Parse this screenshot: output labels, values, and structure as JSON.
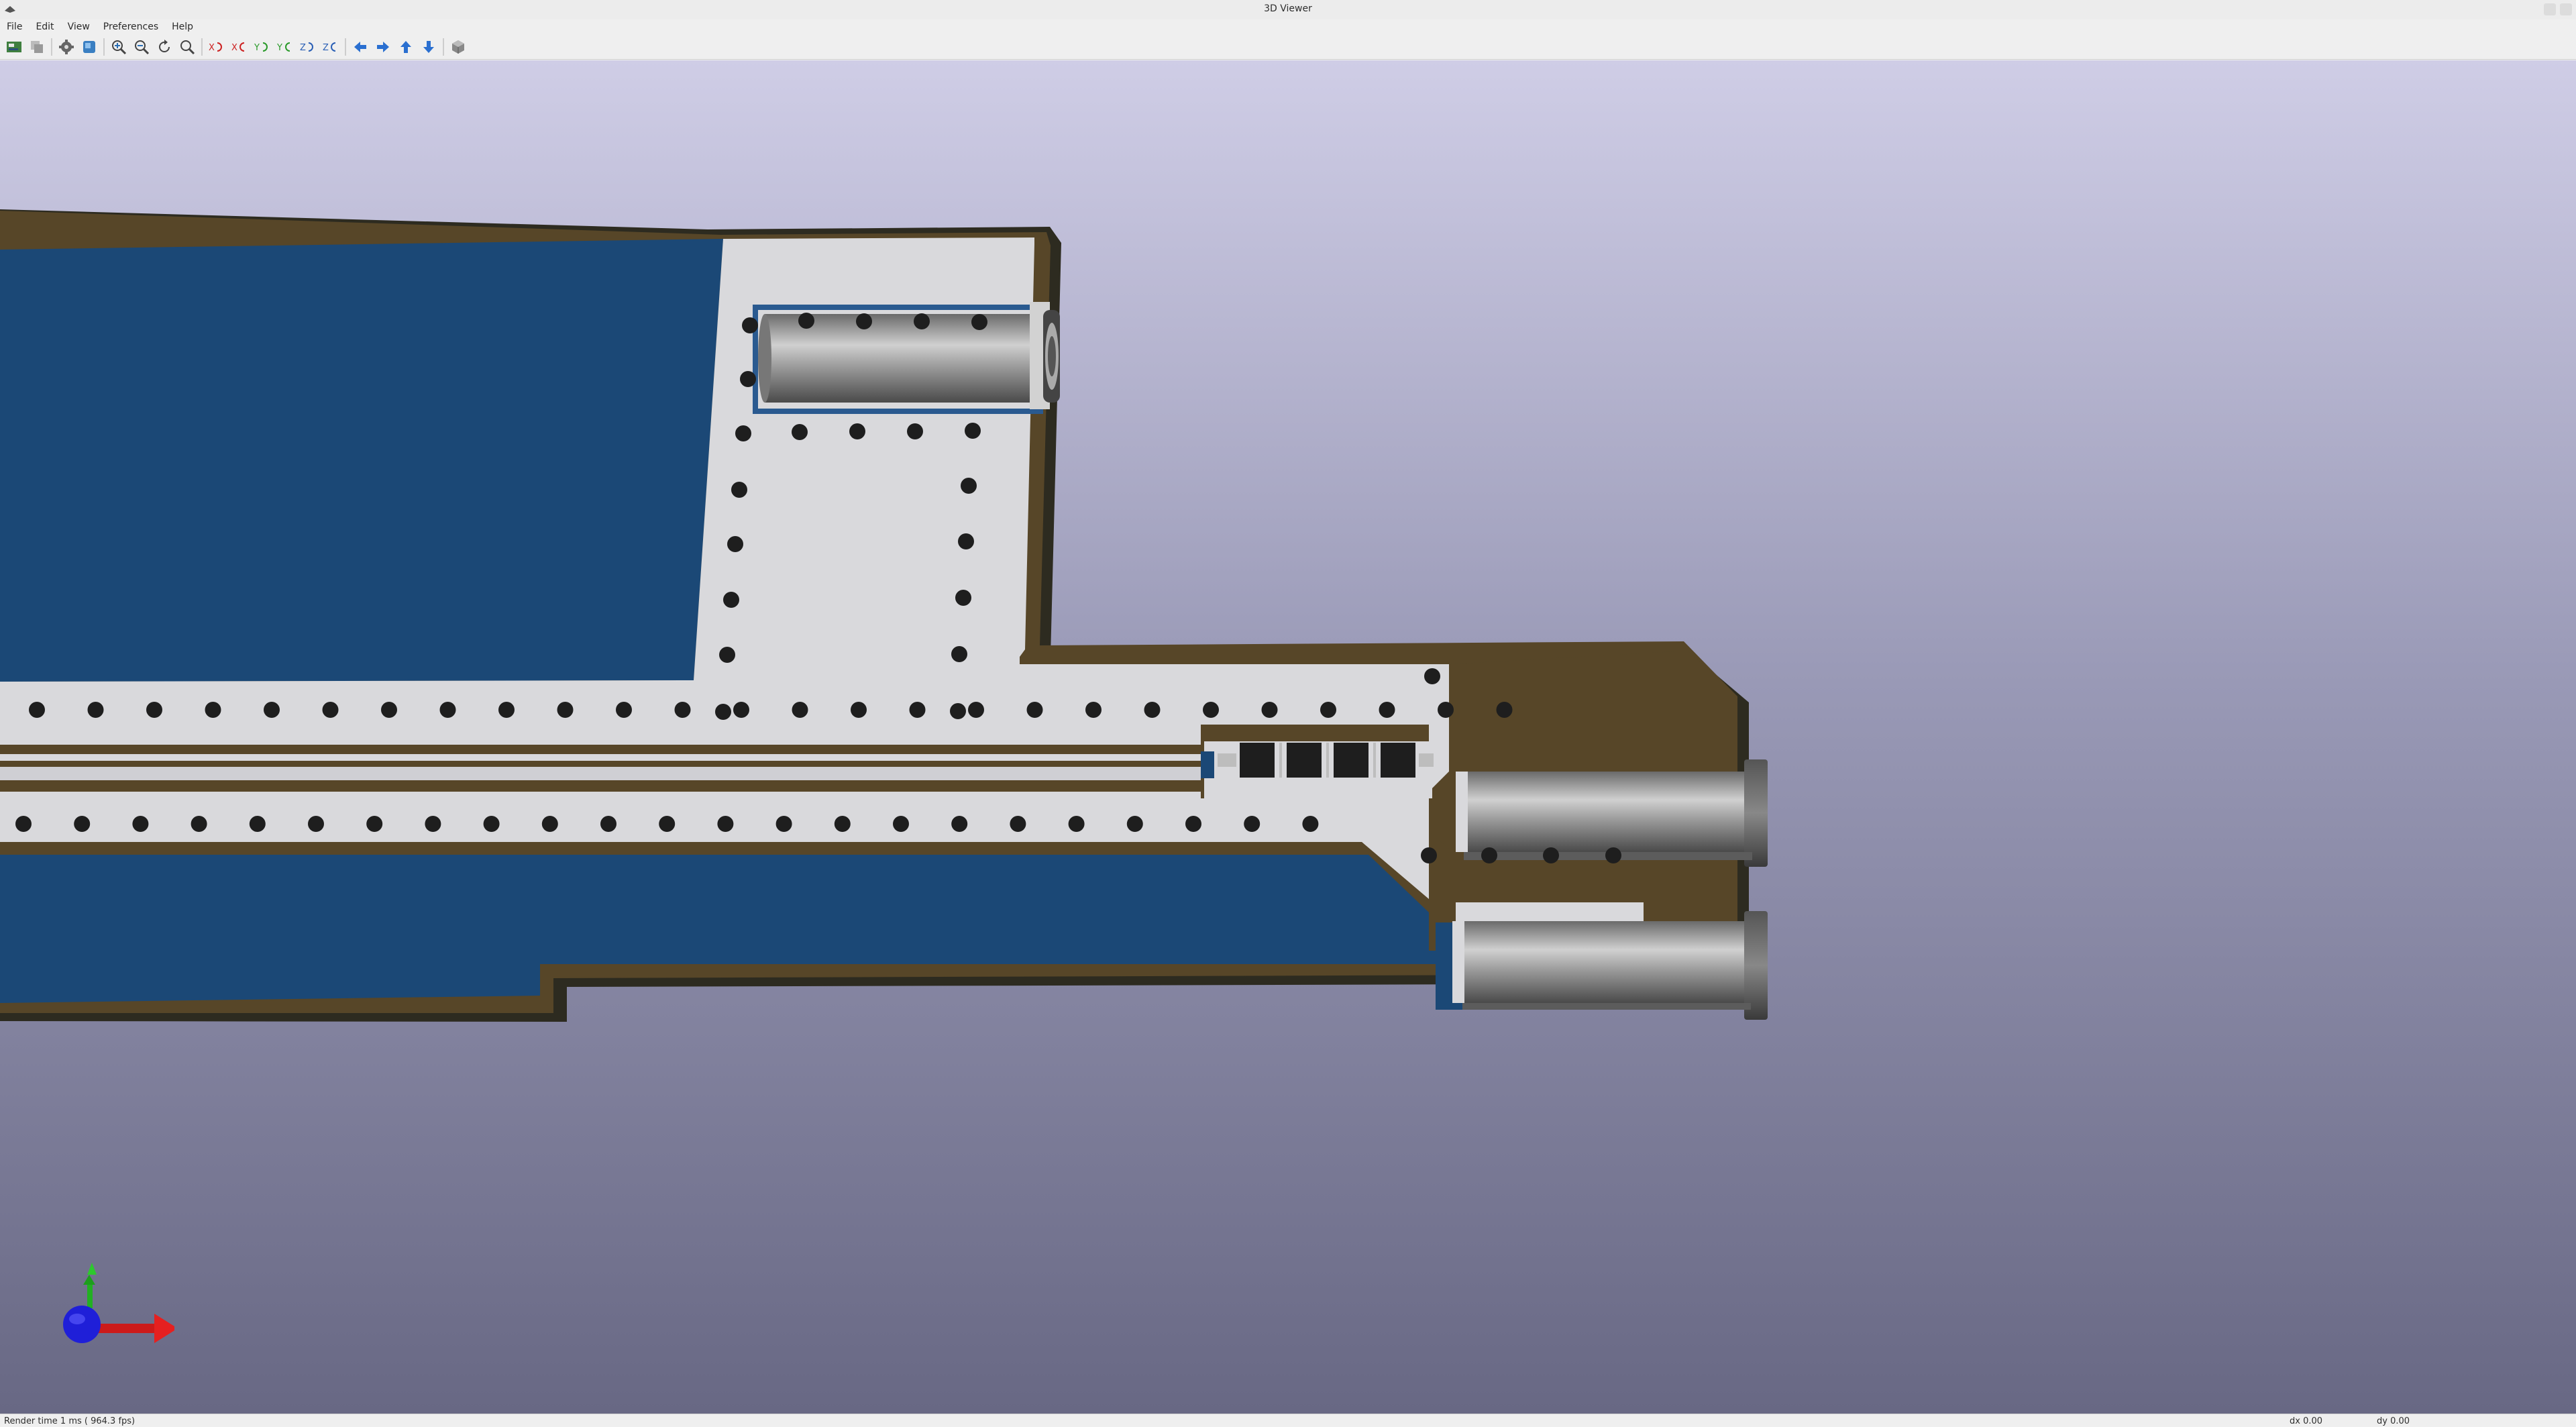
{
  "window": {
    "title": "3D Viewer"
  },
  "menubar": {
    "items": [
      "File",
      "Edit",
      "View",
      "Preferences",
      "Help"
    ]
  },
  "toolbar": {
    "buttons": [
      {
        "icon": "reload-board-icon"
      },
      {
        "icon": "copy-image-icon"
      },
      {
        "icon": "settings-icon"
      },
      {
        "icon": "raytracing-icon"
      },
      {
        "icon": "zoom-in-icon"
      },
      {
        "icon": "zoom-out-icon"
      },
      {
        "icon": "redraw-icon"
      },
      {
        "icon": "zoom-fit-icon"
      },
      {
        "icon": "rotate-x-cw-icon"
      },
      {
        "icon": "rotate-x-ccw-icon"
      },
      {
        "icon": "rotate-y-cw-icon"
      },
      {
        "icon": "rotate-y-ccw-icon"
      },
      {
        "icon": "rotate-z-cw-icon"
      },
      {
        "icon": "rotate-z-ccw-icon"
      },
      {
        "icon": "move-left-icon"
      },
      {
        "icon": "move-right-icon"
      },
      {
        "icon": "move-up-icon"
      },
      {
        "icon": "move-down-icon"
      },
      {
        "icon": "ortho-view-icon"
      }
    ]
  },
  "statusbar": {
    "render_time": "Render time 1 ms ( 964.3 fps)",
    "dx": "dx 0.00",
    "dy": "dy 0.00"
  },
  "colors": {
    "board_blue": "#1b4876",
    "silk_light": "#d9d9dc",
    "board_brown": "#574628",
    "board_edge": "#2d2b20",
    "via_black": "#1e1e1e"
  }
}
